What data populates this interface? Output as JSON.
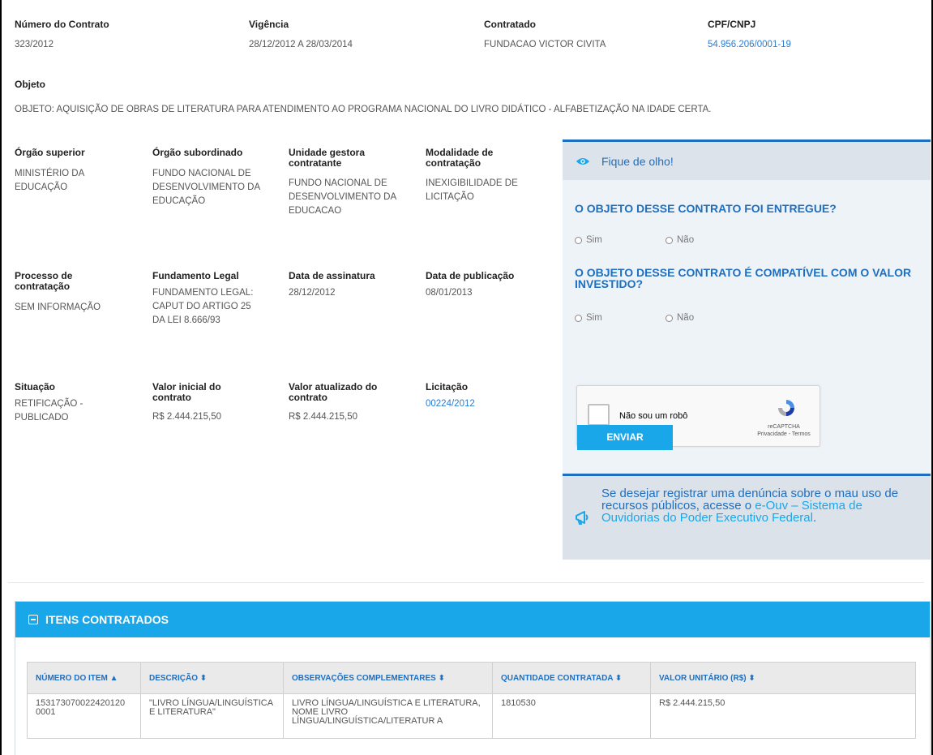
{
  "contract": {
    "numero": {
      "label": "Número do Contrato",
      "value": "323/2012"
    },
    "vigencia": {
      "label": "Vigência",
      "value": "28/12/2012 A 28/03/2014"
    },
    "contratado": {
      "label": "Contratado",
      "value": "FUNDACAO VICTOR CIVITA"
    },
    "cpf_cnpj": {
      "label": "CPF/CNPJ",
      "value": "54.956.206/0001-19"
    },
    "objeto": {
      "label": "Objeto",
      "value": "OBJETO: AQUISIÇÃO DE OBRAS DE LITERATURA PARA ATENDIMENTO AO PROGRAMA NACIONAL DO LIVRO DIDÁTICO - ALFABETIZAÇÃO NA IDADE CERTA."
    }
  },
  "details": {
    "orgao_superior": {
      "label": "Órgão superior",
      "value": "MINISTÉRIO DA EDUCAÇÃO"
    },
    "orgao_subordinado": {
      "label": "Órgão subordinado",
      "value": "FUNDO NACIONAL DE DESENVOLVIMENTO DA EDUCAÇÃO"
    },
    "unidade_gestora": {
      "label": "Unidade gestora contratante",
      "value": "FUNDO NACIONAL DE DESENVOLVIMENTO DA EDUCACAO"
    },
    "modalidade": {
      "label": "Modalidade de contratação",
      "value": "INEXIGIBILIDADE DE LICITAÇÃO"
    },
    "processo": {
      "label": "Processo de contratação",
      "value": "SEM INFORMAÇÃO"
    },
    "fundamento": {
      "label": "Fundamento Legal",
      "value": "FUNDAMENTO LEGAL: CAPUT DO ARTIGO 25 DA LEI 8.666/93"
    },
    "data_assinatura": {
      "label": "Data de assinatura",
      "value": "28/12/2012"
    },
    "data_publicacao": {
      "label": "Data de publicação",
      "value": "08/01/2013"
    },
    "situacao": {
      "label": "Situação",
      "value": "RETIFICAÇÃO - PUBLICADO"
    },
    "valor_inicial": {
      "label": "Valor inicial do contrato",
      "value": "R$ 2.444.215,50"
    },
    "valor_atualizado": {
      "label": "Valor atualizado do contrato",
      "value": "R$ 2.444.215,50"
    },
    "licitacao": {
      "label": "Licitação",
      "value": "00224/2012"
    }
  },
  "panel": {
    "title": "Fique de olho!",
    "q1": "O OBJETO DESSE CONTRATO FOI ENTREGUE?",
    "q2": "O OBJETO DESSE CONTRATO É COMPATÍVEL COM O VALOR INVESTIDO?",
    "sim": "Sim",
    "nao": "Não",
    "captcha_text": "Não sou um robô",
    "captcha_brand": "reCAPTCHA",
    "captcha_links": "Privacidade - Termos",
    "send": "ENVIAR",
    "footer_pre": "Se desejar registrar uma denúncia sobre o mau uso de recursos públicos, acesse o",
    "footer_link": "e-Ouv – Sistema de Ouvidorias do Poder Executivo Federal",
    "footer_post": "."
  },
  "items": {
    "title": "ITENS CONTRATADOS",
    "headers": [
      "NÚMERO DO ITEM",
      "DESCRIÇÃO",
      "OBSERVAÇÕES COMPLEMENTARES",
      "QUANTIDADE CONTRATADA",
      "VALOR UNITÁRIO (R$)"
    ],
    "rows": [
      [
        "153173070022420120 0001",
        "\"LIVRO LÍNGUA/LINGUÍSTICA E LITERATURA\"",
        "LIVRO LÍNGUA/LINGUÍSTICA E LITERATURA, NOME LIVRO LÍNGUA/LINGUÍSTICA/LITERATUR A",
        "1810530",
        "R$ 2.444.215,50"
      ]
    ]
  }
}
